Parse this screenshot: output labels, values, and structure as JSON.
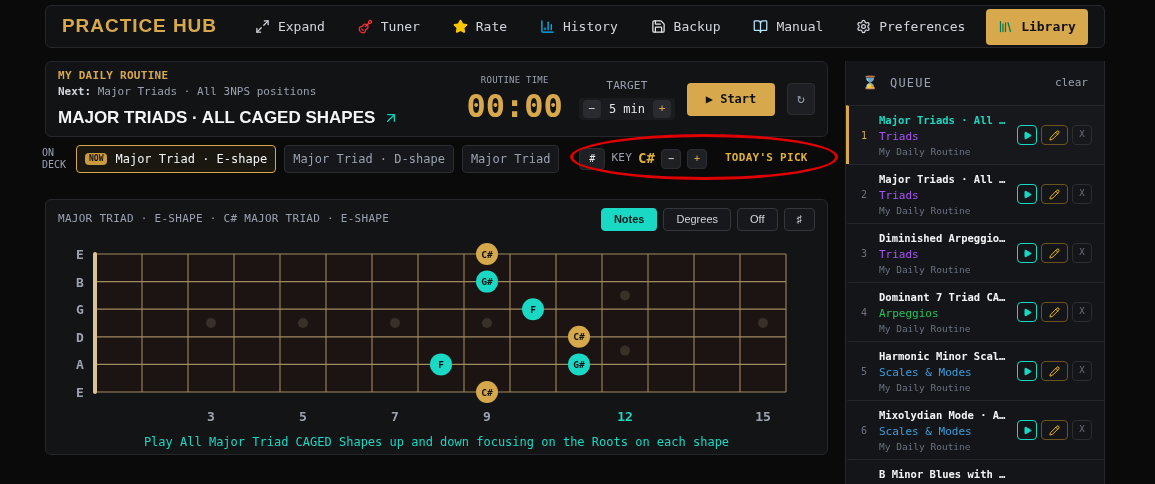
{
  "app_title": "PRACTICE HUB",
  "nav": [
    {
      "label": "Expand",
      "selected": false
    },
    {
      "label": "Tuner",
      "selected": false
    },
    {
      "label": "Rate",
      "selected": false
    },
    {
      "label": "History",
      "selected": false
    },
    {
      "label": "Backup",
      "selected": false
    },
    {
      "label": "Manual",
      "selected": false
    },
    {
      "label": "Preferences",
      "selected": false
    },
    {
      "label": "Library",
      "selected": true
    }
  ],
  "routine": {
    "heading": "MY DAILY ROUTINE",
    "next_label": "Next:",
    "next_value": "Major Triads · All 3NPS positions",
    "title": "MAJOR TRIADS · ALL CAGED SHAPES",
    "time_label": "ROUTINE TIME",
    "time": "00:00",
    "target_label": "TARGET",
    "target_value": "5 min",
    "minus": "−",
    "plus": "+",
    "start": "▶ Start",
    "reset": "↻"
  },
  "on_deck": {
    "label": "ON DECK",
    "items": [
      {
        "badge": "NOW",
        "label": "Major Triad · E-shape",
        "selected": true
      },
      {
        "label": "Major Triad · D-shape",
        "selected": false
      },
      {
        "label": "Major Triad",
        "selected": false
      }
    ]
  },
  "key_controls": {
    "sharp": "#",
    "key_label": "KEY",
    "key": "C#",
    "minus": "−",
    "plus": "+",
    "pick": "TODAY'S PICK",
    "highlighted": true
  },
  "fretboard": {
    "title": "MAJOR TRIAD · E-SHAPE · C# MAJOR TRIAD · E-SHAPE",
    "modes": [
      {
        "label": "Notes",
        "selected": true
      },
      {
        "label": "Degrees",
        "selected": false
      },
      {
        "label": "Off",
        "selected": false
      },
      {
        "label": "♯",
        "selected": false
      }
    ],
    "strings": [
      {
        "label": "E",
        "frets": [
          {
            "kind": "empty"
          },
          {
            "kind": "empty"
          },
          {
            "kind": "empty"
          },
          {
            "kind": "empty"
          },
          {
            "kind": "empty"
          },
          {
            "kind": "empty"
          },
          {
            "kind": "empty"
          },
          {
            "kind": "empty"
          },
          {
            "kind": "note",
            "label": "C#",
            "root": true
          },
          {
            "kind": "empty"
          },
          {
            "kind": "empty"
          },
          {
            "kind": "empty"
          },
          {
            "kind": "empty"
          },
          {
            "kind": "empty"
          },
          {
            "kind": "empty"
          }
        ]
      },
      {
        "label": "B",
        "frets": [
          {
            "kind": "empty"
          },
          {
            "kind": "empty"
          },
          {
            "kind": "empty"
          },
          {
            "kind": "empty"
          },
          {
            "kind": "empty"
          },
          {
            "kind": "empty"
          },
          {
            "kind": "empty"
          },
          {
            "kind": "empty"
          },
          {
            "kind": "note",
            "label": "G#",
            "root": false
          },
          {
            "kind": "empty"
          },
          {
            "kind": "empty"
          },
          {
            "kind": "empty"
          },
          {
            "kind": "empty"
          },
          {
            "kind": "empty"
          },
          {
            "kind": "empty"
          }
        ]
      },
      {
        "label": "G",
        "frets": [
          {
            "kind": "empty"
          },
          {
            "kind": "empty"
          },
          {
            "kind": "empty"
          },
          {
            "kind": "empty"
          },
          {
            "kind": "empty"
          },
          {
            "kind": "empty"
          },
          {
            "kind": "empty"
          },
          {
            "kind": "empty"
          },
          {
            "kind": "empty"
          },
          {
            "kind": "note",
            "label": "F",
            "root": false
          },
          {
            "kind": "empty"
          },
          {
            "kind": "empty"
          },
          {
            "kind": "empty"
          },
          {
            "kind": "empty"
          },
          {
            "kind": "empty"
          }
        ]
      },
      {
        "label": "D",
        "frets": [
          {
            "kind": "empty"
          },
          {
            "kind": "empty"
          },
          {
            "kind": "empty"
          },
          {
            "kind": "empty"
          },
          {
            "kind": "empty"
          },
          {
            "kind": "empty"
          },
          {
            "kind": "empty"
          },
          {
            "kind": "empty"
          },
          {
            "kind": "empty"
          },
          {
            "kind": "empty"
          },
          {
            "kind": "note",
            "label": "C#",
            "root": true
          },
          {
            "kind": "empty"
          },
          {
            "kind": "empty"
          },
          {
            "kind": "empty"
          },
          {
            "kind": "empty"
          }
        ]
      },
      {
        "label": "A",
        "frets": [
          {
            "kind": "empty"
          },
          {
            "kind": "empty"
          },
          {
            "kind": "empty"
          },
          {
            "kind": "empty"
          },
          {
            "kind": "empty"
          },
          {
            "kind": "empty"
          },
          {
            "kind": "empty"
          },
          {
            "kind": "note",
            "label": "F",
            "root": false
          },
          {
            "kind": "empty"
          },
          {
            "kind": "empty"
          },
          {
            "kind": "note",
            "label": "G#",
            "root": false
          },
          {
            "kind": "empty"
          },
          {
            "kind": "empty"
          },
          {
            "kind": "empty"
          },
          {
            "kind": "empty"
          }
        ]
      },
      {
        "label": "E",
        "frets": [
          {
            "kind": "empty"
          },
          {
            "kind": "empty"
          },
          {
            "kind": "empty"
          },
          {
            "kind": "empty"
          },
          {
            "kind": "empty"
          },
          {
            "kind": "empty"
          },
          {
            "kind": "empty"
          },
          {
            "kind": "empty"
          },
          {
            "kind": "note",
            "label": "C#",
            "root": true
          },
          {
            "kind": "empty"
          },
          {
            "kind": "empty"
          },
          {
            "kind": "empty"
          },
          {
            "kind": "empty"
          },
          {
            "kind": "empty"
          },
          {
            "kind": "empty"
          }
        ]
      }
    ],
    "fret_labels": [
      {
        "kind": "blank"
      },
      {
        "kind": "blank"
      },
      {
        "kind": "number",
        "label": "3",
        "selected": false
      },
      {
        "kind": "blank"
      },
      {
        "kind": "number",
        "label": "5",
        "selected": false
      },
      {
        "kind": "blank"
      },
      {
        "kind": "number",
        "label": "7",
        "selected": false
      },
      {
        "kind": "blank"
      },
      {
        "kind": "number",
        "label": "9",
        "selected": false
      },
      {
        "kind": "blank"
      },
      {
        "kind": "blank"
      },
      {
        "kind": "number",
        "label": "12",
        "selected": true
      },
      {
        "kind": "blank"
      },
      {
        "kind": "blank"
      },
      {
        "kind": "number",
        "label": "15",
        "selected": false
      }
    ],
    "caption": "Play All Major Triad CAGED Shapes up and down focusing on the Roots on each shape"
  },
  "queue": {
    "icon": "⌛",
    "title": "QUEUE",
    "clear": "clear",
    "items": [
      {
        "number": "1",
        "name": "Major Triads · All …",
        "category": "Triads",
        "color": "#a855f7",
        "source": "My Daily Routine",
        "remove": "X",
        "selected": true
      },
      {
        "number": "2",
        "name": "Major Triads · All …",
        "category": "Triads",
        "color": "#a855f7",
        "source": "My Daily Routine",
        "remove": "X",
        "selected": false
      },
      {
        "number": "3",
        "name": "Diminished Arpeggio…",
        "category": "Triads",
        "color": "#a855f7",
        "source": "My Daily Routine",
        "remove": "X",
        "selected": false
      },
      {
        "number": "4",
        "name": "Dominant 7 Triad CA…",
        "category": "Arpeggios",
        "color": "#22c55e",
        "source": "My Daily Routine",
        "remove": "X",
        "selected": false
      },
      {
        "number": "5",
        "name": "Harmonic Minor Scal…",
        "category": "Scales & Modes",
        "color": "#3b9ede",
        "source": "My Daily Routine",
        "remove": "X",
        "selected": false
      },
      {
        "number": "6",
        "name": "Mixolydian Mode · A…",
        "category": "Scales & Modes",
        "color": "#3b9ede",
        "source": "My Daily Routine",
        "remove": "X",
        "selected": false
      },
      {
        "name": "B Minor Blues with …",
        "selected": false
      }
    ]
  }
}
